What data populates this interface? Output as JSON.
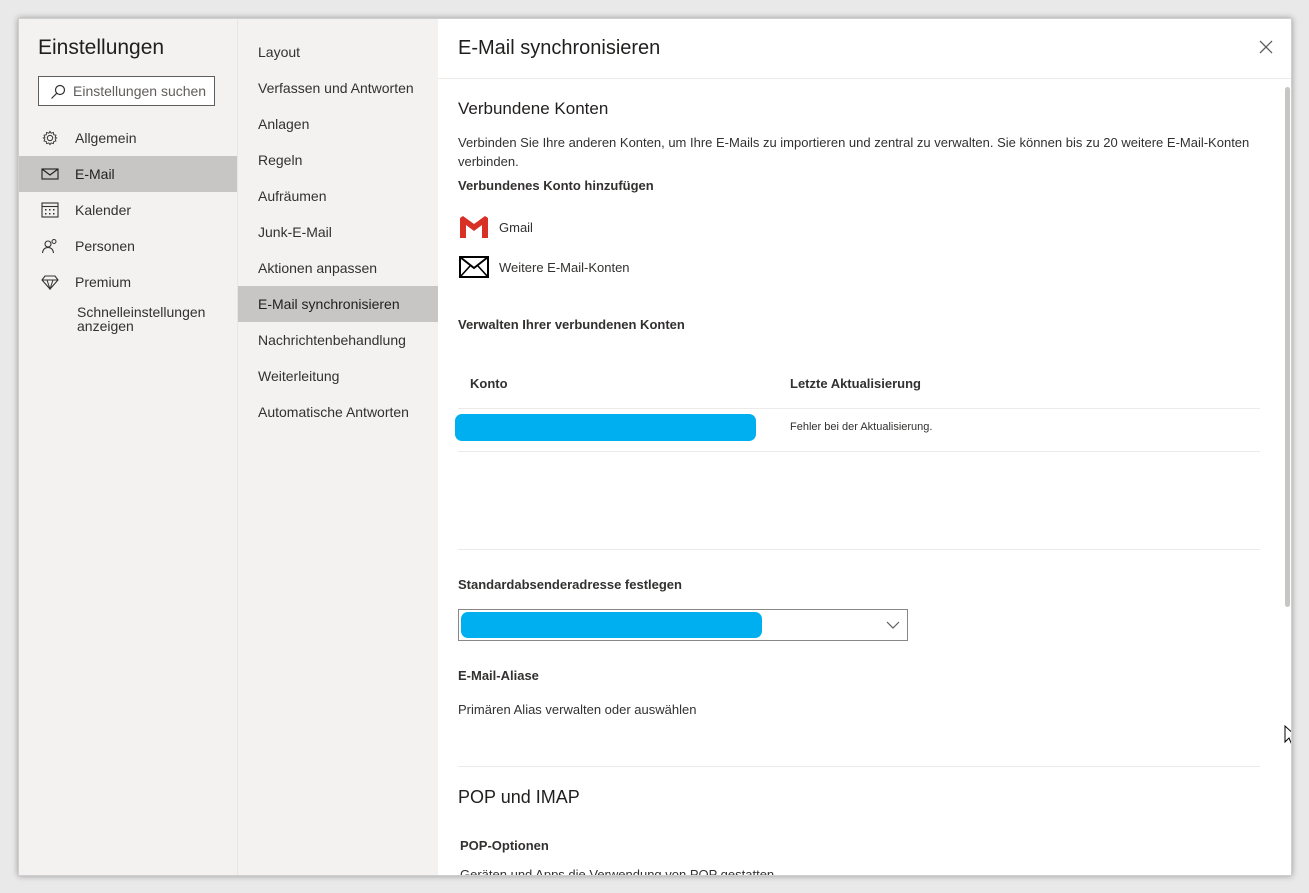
{
  "app": {
    "title": "Einstellungen",
    "search_placeholder": "Einstellungen suchen"
  },
  "nav_primary": {
    "items": [
      {
        "label": "Allgemein",
        "icon": "gear-icon",
        "selected": false
      },
      {
        "label": "E-Mail",
        "icon": "mail-icon",
        "selected": true
      },
      {
        "label": "Kalender",
        "icon": "calendar-icon",
        "selected": false
      },
      {
        "label": "Personen",
        "icon": "people-icon",
        "selected": false
      },
      {
        "label": "Premium",
        "icon": "diamond-icon",
        "selected": false
      }
    ],
    "quick_settings_line1": "Schnelleinstellungen",
    "quick_settings_line2": "anzeigen"
  },
  "nav_secondary": {
    "items": [
      {
        "label": "Layout",
        "selected": false
      },
      {
        "label": "Verfassen und Antworten",
        "selected": false
      },
      {
        "label": "Anlagen",
        "selected": false
      },
      {
        "label": "Regeln",
        "selected": false
      },
      {
        "label": "Aufräumen",
        "selected": false
      },
      {
        "label": "Junk-E-Mail",
        "selected": false
      },
      {
        "label": "Aktionen anpassen",
        "selected": false
      },
      {
        "label": "E-Mail synchronisieren",
        "selected": true
      },
      {
        "label": "Nachrichtenbehandlung",
        "selected": false
      },
      {
        "label": "Weiterleitung",
        "selected": false
      },
      {
        "label": "Automatische Antworten",
        "selected": false
      }
    ]
  },
  "content": {
    "title": "E-Mail synchronisieren",
    "connected_accounts": {
      "heading": "Verbundene Konten",
      "description": "Verbinden Sie Ihre anderen Konten, um Ihre E-Mails zu importieren und zentral zu verwalten. Sie können bis zu 20 weitere E-Mail-Konten verbinden.",
      "add_heading": "Verbundenes Konto hinzufügen",
      "options": [
        {
          "label": "Gmail",
          "icon": "gmail-icon"
        },
        {
          "label": "Weitere E-Mail-Konten",
          "icon": "envelope-icon"
        }
      ],
      "manage_heading": "Verwalten Ihrer verbundenen Konten",
      "table": {
        "columns": [
          "Konto",
          "Letzte Aktualisierung"
        ],
        "rows": [
          {
            "account": "",
            "status": "Fehler bei der Aktualisierung."
          }
        ]
      }
    },
    "default_sender": {
      "label": "Standardabsenderadresse festlegen",
      "selected_value": ""
    },
    "aliases": {
      "heading": "E-Mail-Aliase",
      "text": "Primären Alias verwalten oder auswählen"
    },
    "pop_imap": {
      "heading": "POP und IMAP",
      "pop_options": "POP-Optionen",
      "pop_text": "Geräten und Apps die Verwendung von POP gestatten"
    }
  },
  "colors": {
    "redaction": "#00aff0",
    "nav_background": "#f3f2f1",
    "selected_background": "#c8c6c4",
    "gmail_red": "#d93025"
  }
}
